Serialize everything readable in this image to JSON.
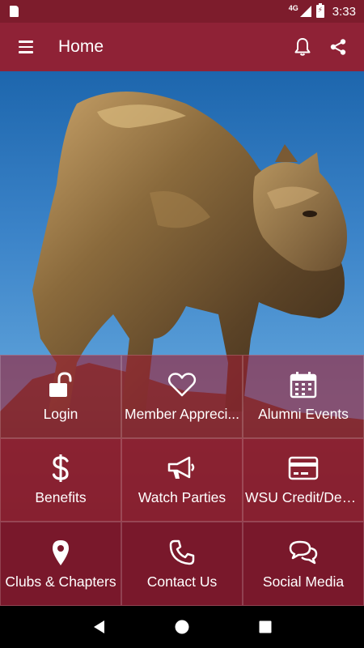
{
  "status_bar": {
    "network": "4G",
    "time": "3:33"
  },
  "app_bar": {
    "title": "Home",
    "actions": [
      {
        "name": "notifications",
        "icon": "bell-icon"
      },
      {
        "name": "share",
        "icon": "share-icon"
      }
    ]
  },
  "tiles": [
    {
      "label": "Login",
      "icon": "lock-open-icon"
    },
    {
      "label": "Member Appreci...",
      "icon": "heart-icon"
    },
    {
      "label": "Alumni Events",
      "icon": "calendar-icon"
    },
    {
      "label": "Benefits",
      "icon": "dollar-icon"
    },
    {
      "label": "Watch Parties",
      "icon": "megaphone-icon"
    },
    {
      "label": "WSU Credit/Debi...",
      "icon": "credit-card-icon"
    },
    {
      "label": "Clubs & Chapters",
      "icon": "map-pin-icon"
    },
    {
      "label": "Contact Us",
      "icon": "phone-icon"
    },
    {
      "label": "Social Media",
      "icon": "chat-bubbles-icon"
    }
  ],
  "colors": {
    "status_bar": "#7d1c2c",
    "app_bar": "#8f2236",
    "tile_bottom": "#79182b"
  }
}
